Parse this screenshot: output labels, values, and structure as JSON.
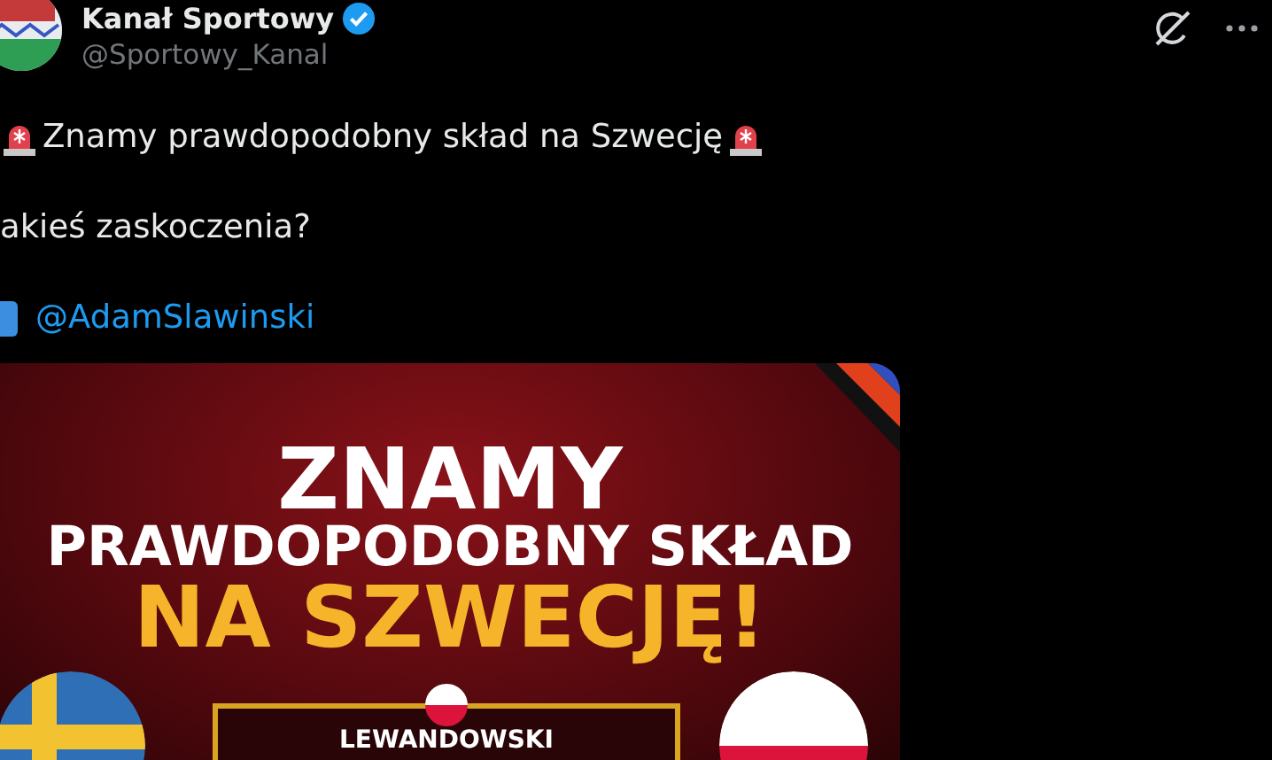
{
  "author": {
    "name": "Kanał Sportowy",
    "verified": true,
    "handle": "@Sportowy_Kanal"
  },
  "tweet": {
    "headline": "Znamy prawdopodobny skład na Szwecję",
    "question": "akieś zaskoczenia?",
    "mention": "@AdamSlawinski"
  },
  "media": {
    "headline": "ZNAMY",
    "subline": "PRAWDOPODOBNY SKŁAD",
    "highlight": "NA SZWECJĘ!",
    "player": "LEWANDOWSKI"
  }
}
